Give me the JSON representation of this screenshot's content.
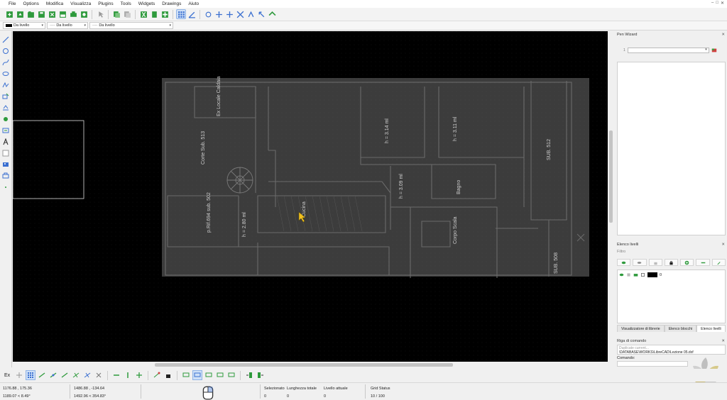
{
  "menu": [
    "File",
    "Options",
    "Modifica",
    "Visualizza",
    "Plugins",
    "Tools",
    "Widgets",
    "Drawings",
    "Aiuto"
  ],
  "window_controls": [
    "–",
    "□",
    "✕"
  ],
  "pen": {
    "color_value": "Da livello",
    "width_value": "Da livello",
    "linetype_value": "Da livello",
    "color_swatch": "#000000"
  },
  "drawing": {
    "rooms": [
      {
        "label": "Ex Locale Caldaia"
      },
      {
        "label": "Corte Sub. 513"
      },
      {
        "label": "h = 3.14 ml"
      },
      {
        "label": "h = 3.11 ml"
      },
      {
        "label": "SUB. 512"
      },
      {
        "label": "h = 3.09 ml"
      },
      {
        "label": "Bagno"
      },
      {
        "label": "p.Rif.694 sub. 502"
      },
      {
        "label": "h = 2.80 ml"
      },
      {
        "label": "Cucina"
      },
      {
        "label": "Corpo Scala"
      },
      {
        "label": "SUB. 508"
      }
    ],
    "cursor_color": "#f0c020"
  },
  "pen_wizard": {
    "title": "Pen Wizard",
    "close": "✕",
    "index": "1"
  },
  "layers": {
    "title": "Elenco livelli",
    "close": "✕",
    "filter_placeholder": "Filtro",
    "rows": [
      {
        "name": "0",
        "color": "#000000"
      }
    ],
    "tabs": [
      "Visualizzatore di librerie",
      "Elenco blocchi",
      "Elenco livelli"
    ],
    "active_tab": 2
  },
  "command": {
    "title": "Riga di comando",
    "close": "✕",
    "history": [
      "Duplicate current...",
      "\\DATABASE\\WORKS\\LibreCAD\\Lezione 05.dxf"
    ],
    "label": "Comando:"
  },
  "snap": {
    "label": "Ex"
  },
  "status": {
    "abs_coord": "1176.88 , 175.36",
    "abs_polar": "1189.07 < 8.49°",
    "rel_coord": "1486.88 , -134.64",
    "rel_polar": "1492.96 < 354.83°",
    "selected_label": "Selezionato",
    "selected_value": "0",
    "length_label": "Lunghezza totale",
    "length_value": "0",
    "layer_label": "Livello attuale",
    "layer_value": "0",
    "grid_label": "Grid Status",
    "grid_value": "10 / 100"
  },
  "colors": {
    "canvas_bg": "#000000",
    "plan_bg": "#3c3c3c",
    "plan_line": "#6a6a6a",
    "toolbar_green": "#2e9a3c",
    "accent_blue": "#3a6fd0"
  }
}
